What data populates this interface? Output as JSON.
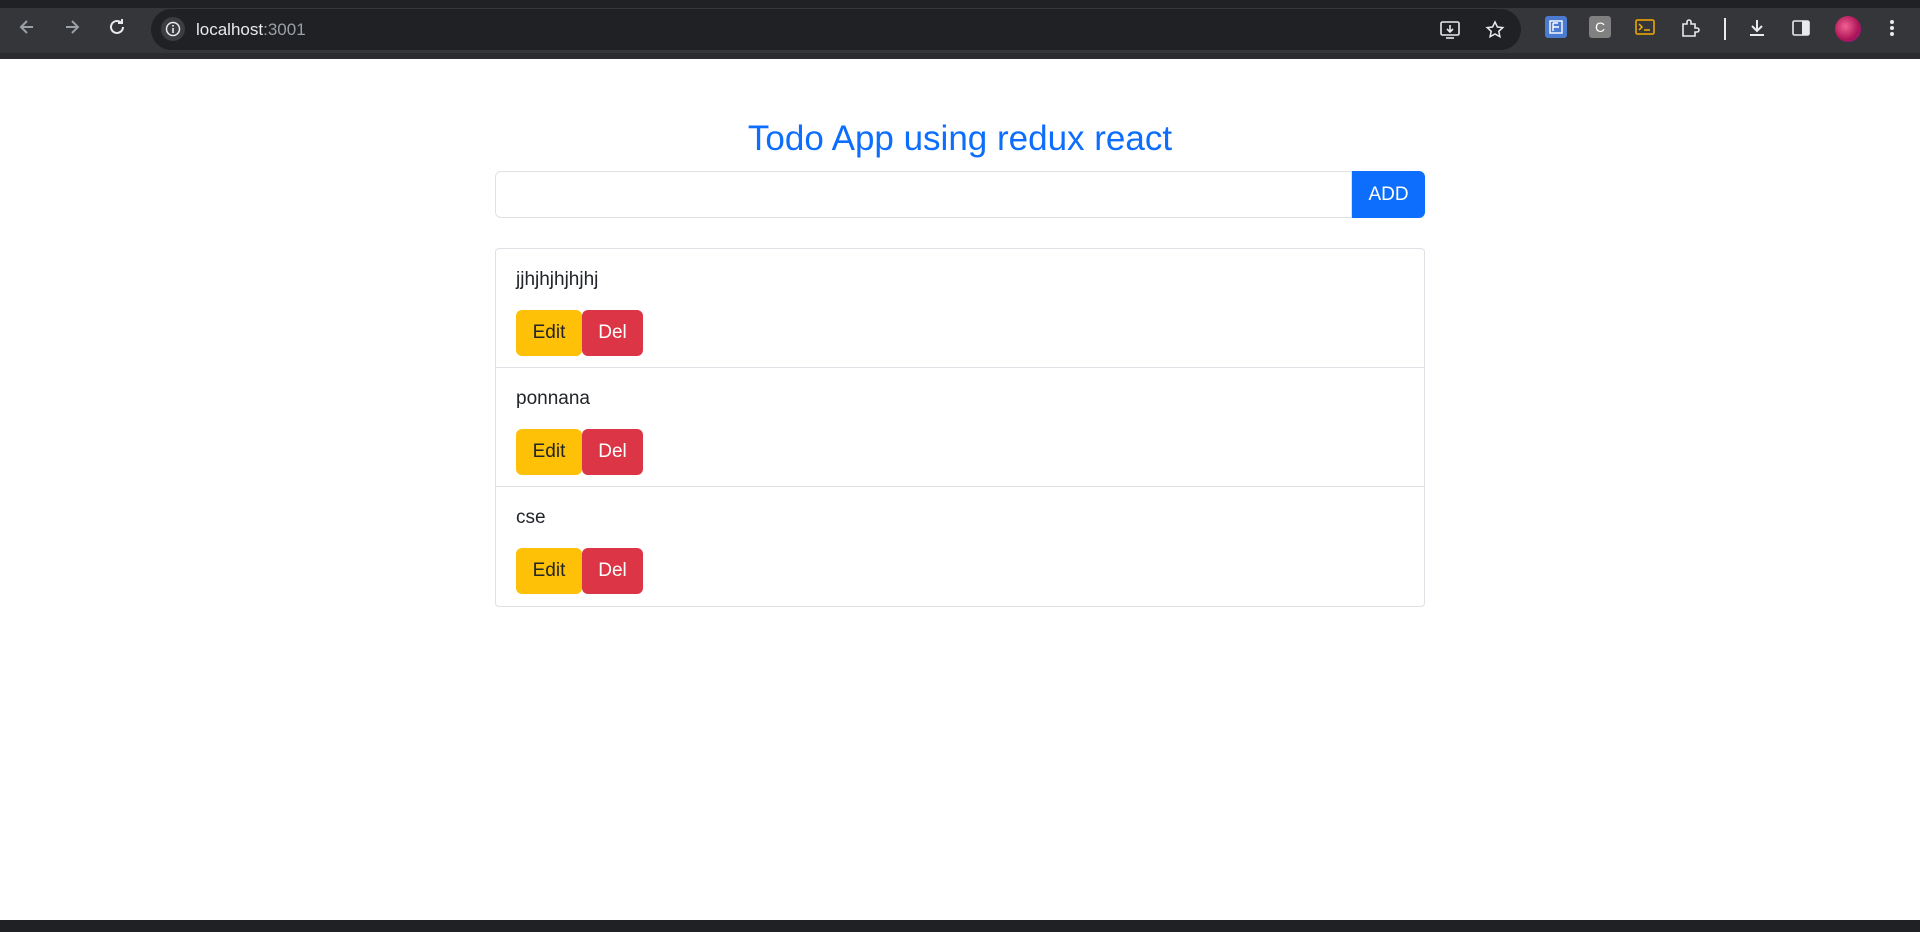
{
  "browser": {
    "url_host": "localhost",
    "url_port": ":3001",
    "icons": {
      "back": "arrow-left-icon",
      "forward": "arrow-right-icon",
      "reload": "reload-icon",
      "site_info": "info-icon",
      "install": "install-app-icon",
      "bookmark": "star-icon",
      "extensions": "puzzle-icon",
      "downloads": "download-icon",
      "side_panel": "side-panel-icon",
      "menu": "kebab-menu-icon"
    },
    "extension_labels": [
      "C"
    ]
  },
  "app": {
    "title": "Todo App using redux react",
    "input_value": "",
    "add_label": "ADD",
    "todos": [
      {
        "text": "jjhjhjhjhjhj",
        "edit_label": "Edit",
        "del_label": "Del"
      },
      {
        "text": "ponnana",
        "edit_label": "Edit",
        "del_label": "Del"
      },
      {
        "text": "cse",
        "edit_label": "Edit",
        "del_label": "Del"
      }
    ]
  },
  "colors": {
    "primary": "#0d6efd",
    "warning": "#ffc107",
    "danger": "#dc3545",
    "chrome_bg": "#35363a"
  }
}
